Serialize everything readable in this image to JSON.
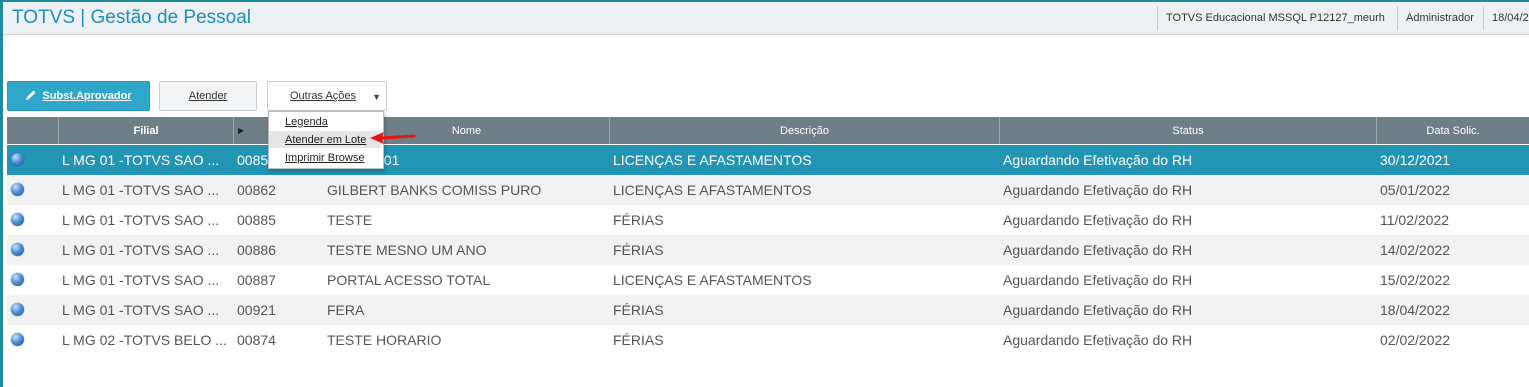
{
  "header": {
    "app_title": "TOTVS | Gestão de Pessoal",
    "environment": "TOTVS Educacional MSSQL P12127_meurh",
    "user": "Administrador",
    "date": "18/04/20"
  },
  "toolbar": {
    "subst_label": "Subst.Aprovador",
    "atender_label": "Atender",
    "outras_label": "Outras Ações",
    "pencil_icon": "pencil-icon",
    "primary_color": "#2ea7cb"
  },
  "menu": {
    "items": [
      "Legenda",
      "Atender em Lote",
      "Imprimir Browse"
    ],
    "highlighted": "Atender em Lote"
  },
  "grid": {
    "columns": [
      "",
      "Filial",
      "",
      "Nome",
      "Descrição",
      "Status",
      "Data Solic."
    ],
    "selected_color": "#2294b4",
    "rows": [
      {
        "filial": "L MG 01 -TOTVS SAO ...",
        "codigo": "00851",
        "nome": "TESTE 101",
        "descricao": "LICENÇAS E AFASTAMENTOS",
        "status": "Aguardando Efetivação do RH",
        "data": "30/12/2021"
      },
      {
        "filial": "L MG 01 -TOTVS SAO ...",
        "codigo": "00862",
        "nome": "GILBERT BANKS COMISS PURO",
        "descricao": "LICENÇAS E AFASTAMENTOS",
        "status": "Aguardando Efetivação do RH",
        "data": "05/01/2022"
      },
      {
        "filial": "L MG 01 -TOTVS SAO ...",
        "codigo": "00885",
        "nome": "TESTE",
        "descricao": "FÉRIAS",
        "status": "Aguardando Efetivação do RH",
        "data": "11/02/2022"
      },
      {
        "filial": "L MG 01 -TOTVS SAO ...",
        "codigo": "00886",
        "nome": "TESTE MESNO UM ANO",
        "descricao": "FÉRIAS",
        "status": "Aguardando Efetivação do RH",
        "data": "14/02/2022"
      },
      {
        "filial": "L MG 01 -TOTVS SAO ...",
        "codigo": "00887",
        "nome": "PORTAL ACESSO TOTAL",
        "descricao": "LICENÇAS E AFASTAMENTOS",
        "status": "Aguardando Efetivação do RH",
        "data": "15/02/2022"
      },
      {
        "filial": "L MG 01 -TOTVS SAO ...",
        "codigo": "00921",
        "nome": "FERA",
        "descricao": "FÉRIAS",
        "status": "Aguardando Efetivação do RH",
        "data": "18/04/2022"
      },
      {
        "filial": "L MG 02 -TOTVS BELO ...",
        "codigo": "00874",
        "nome": "TESTE HORARIO",
        "descricao": "FÉRIAS",
        "status": "Aguardando Efetivação do RH",
        "data": "02/02/2022"
      }
    ]
  }
}
